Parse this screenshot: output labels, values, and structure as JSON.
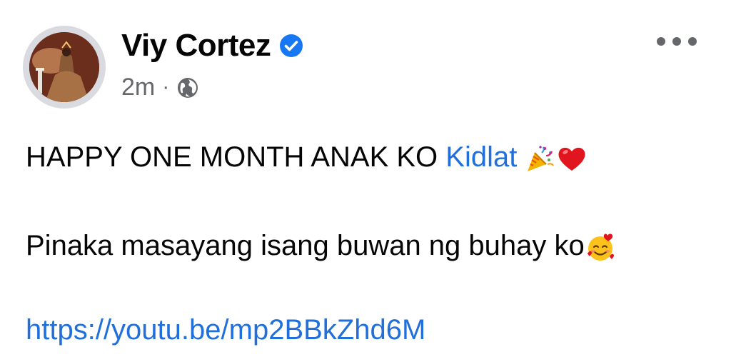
{
  "author": {
    "name": "Viy Cortez",
    "verified_icon": "verified-badge-icon",
    "verified_color": "#1877f2"
  },
  "meta": {
    "time": "2m",
    "separator": "·",
    "audience_icon": "globe-icon"
  },
  "post": {
    "line1_text": "HAPPY ONE MONTH ANAK KO ",
    "line1_mention": "Kidlat",
    "line1_emojis": [
      "party-popper-icon",
      "red-heart-icon"
    ],
    "line2_text": "Pinaka masayang isang buwan ng buhay ko",
    "line2_emoji": "smiling-face-with-hearts-icon",
    "link": "https://youtu.be/mp2BBkZhd6M"
  },
  "colors": {
    "link": "#216fdb",
    "secondary_text": "#65676b",
    "primary_text": "#050505"
  }
}
